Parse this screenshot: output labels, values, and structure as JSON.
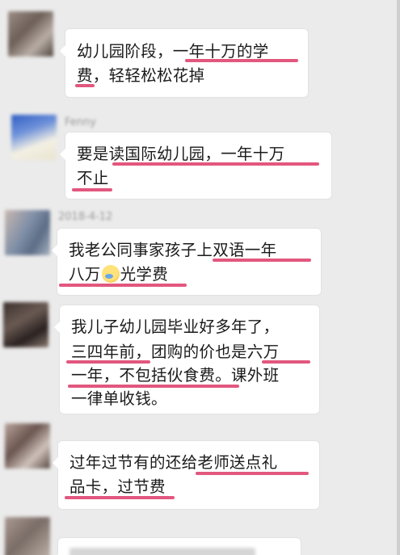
{
  "chat": {
    "messages": [
      {
        "sender": "",
        "lines": [
          "幼儿园阶段，一年十万的学",
          "费，轻轻松松花掉"
        ]
      },
      {
        "sender": "Fenny",
        "lines": [
          "要是读国际幼儿园，一年十万",
          "不止"
        ]
      },
      {
        "sender": "2018-4-12",
        "lines": [
          "我老公同事家孩子上双语一年",
          "八万",
          "光学费"
        ]
      },
      {
        "sender": "",
        "lines": [
          "我儿子幼儿园毕业好多年了，",
          "三四年前，团购的价也是六万",
          "一年，不包括伙食费。课外班",
          "一律单收钱。"
        ]
      },
      {
        "sender": "",
        "lines": [
          "过年过节有的还给老师送点礼",
          "品卡，过节费"
        ]
      },
      {
        "sender": "",
        "lines": []
      }
    ]
  },
  "colors": {
    "highlight": "#e2577e",
    "bubble": "#ffffff",
    "background": "#ebebeb"
  },
  "icons": {
    "emoji": "embarrassed-emoji-icon"
  }
}
